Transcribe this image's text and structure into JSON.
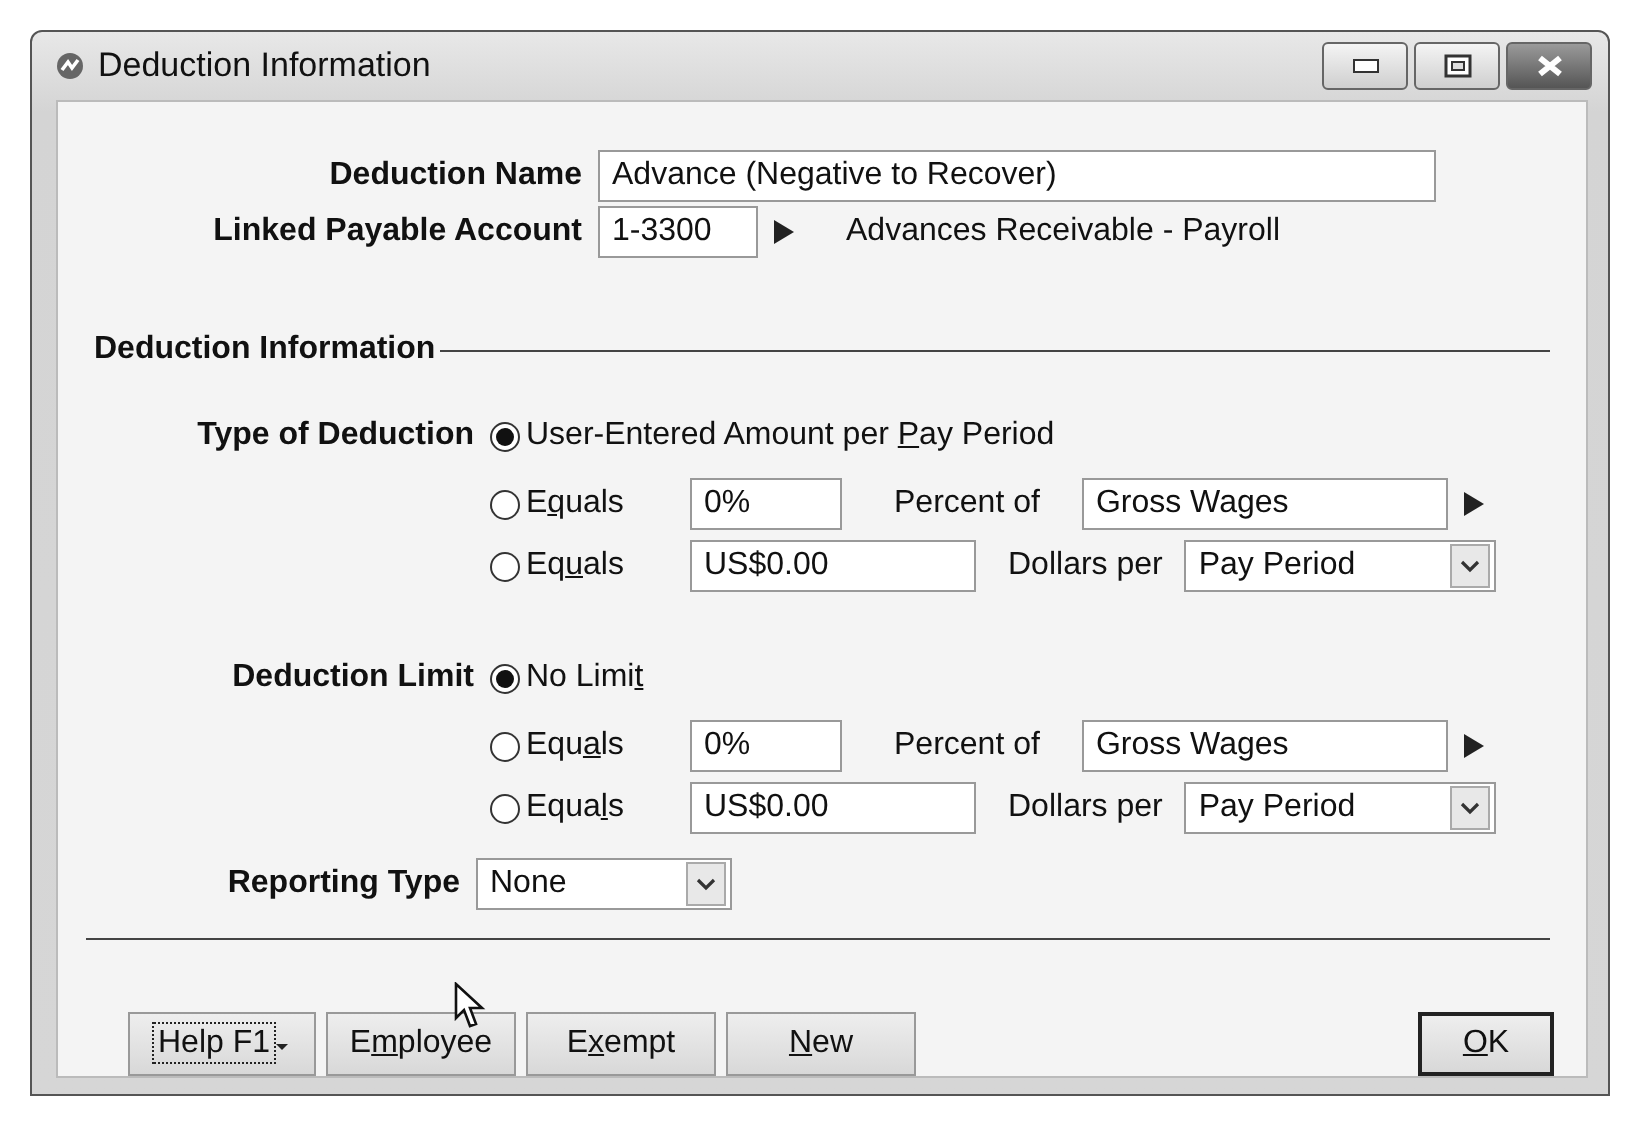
{
  "window": {
    "title": "Deduction Information"
  },
  "deduction_name": {
    "label": "Deduction Name",
    "value": "Advance (Negative to Recover)"
  },
  "linked_account": {
    "label": "Linked Payable Account",
    "value": "1-3300",
    "account_name": "Advances Receivable - Payroll"
  },
  "section": {
    "title": "Deduction Information"
  },
  "groups": [
    {
      "label": "Type of Deduction",
      "options": [
        {
          "kind": "plain",
          "selected": true,
          "label": [
            {
              "t": "User-Entered Amount per ",
              "u": false
            },
            {
              "t": "P",
              "u": true
            },
            {
              "t": "ay Period",
              "u": false
            }
          ]
        },
        {
          "kind": "percent",
          "selected": false,
          "label": [
            {
              "t": "E",
              "u": false
            },
            {
              "t": "q",
              "u": true
            },
            {
              "t": "uals",
              "u": false
            }
          ],
          "value": "0%",
          "unit": "Percent of",
          "basis": "Gross Wages"
        },
        {
          "kind": "dollars",
          "selected": false,
          "label": [
            {
              "t": "Eq",
              "u": false
            },
            {
              "t": "u",
              "u": true
            },
            {
              "t": "als",
              "u": false
            }
          ],
          "value": "US$0.00",
          "unit": "Dollars per",
          "basis": "Pay Period"
        }
      ]
    },
    {
      "label": "Deduction Limit",
      "options": [
        {
          "kind": "plain",
          "selected": true,
          "label": [
            {
              "t": "No Limi",
              "u": false
            },
            {
              "t": "t",
              "u": true
            }
          ]
        },
        {
          "kind": "percent",
          "selected": false,
          "label": [
            {
              "t": "Equ",
              "u": false
            },
            {
              "t": "a",
              "u": true
            },
            {
              "t": "ls",
              "u": false
            }
          ],
          "value": "0%",
          "unit": "Percent of",
          "basis": "Gross Wages"
        },
        {
          "kind": "dollars",
          "selected": false,
          "label": [
            {
              "t": "Equa",
              "u": false
            },
            {
              "t": "l",
              "u": true
            },
            {
              "t": "s",
              "u": false
            }
          ],
          "value": "US$0.00",
          "unit": "Dollars per",
          "basis": "Pay Period"
        }
      ]
    }
  ],
  "reporting_type": {
    "label": "Reporting Type",
    "value": "None"
  },
  "buttons": [
    {
      "kind": "help",
      "focused": true,
      "label": [
        {
          "t": "Help F1",
          "u": false
        }
      ]
    },
    {
      "kind": "normal",
      "focused": false,
      "label": [
        {
          "t": "E",
          "u": false
        },
        {
          "t": "m",
          "u": true
        },
        {
          "t": "ployee",
          "u": false
        }
      ]
    },
    {
      "kind": "normal",
      "focused": false,
      "label": [
        {
          "t": "E",
          "u": false
        },
        {
          "t": "x",
          "u": true
        },
        {
          "t": "empt",
          "u": false
        }
      ]
    },
    {
      "kind": "normal",
      "focused": false,
      "label": [
        {
          "t": "N",
          "u": true
        },
        {
          "t": "ew",
          "u": false
        }
      ]
    }
  ],
  "ok_button": {
    "default": true,
    "label": [
      {
        "t": "O",
        "u": true
      },
      {
        "t": "K",
        "u": false
      }
    ]
  }
}
